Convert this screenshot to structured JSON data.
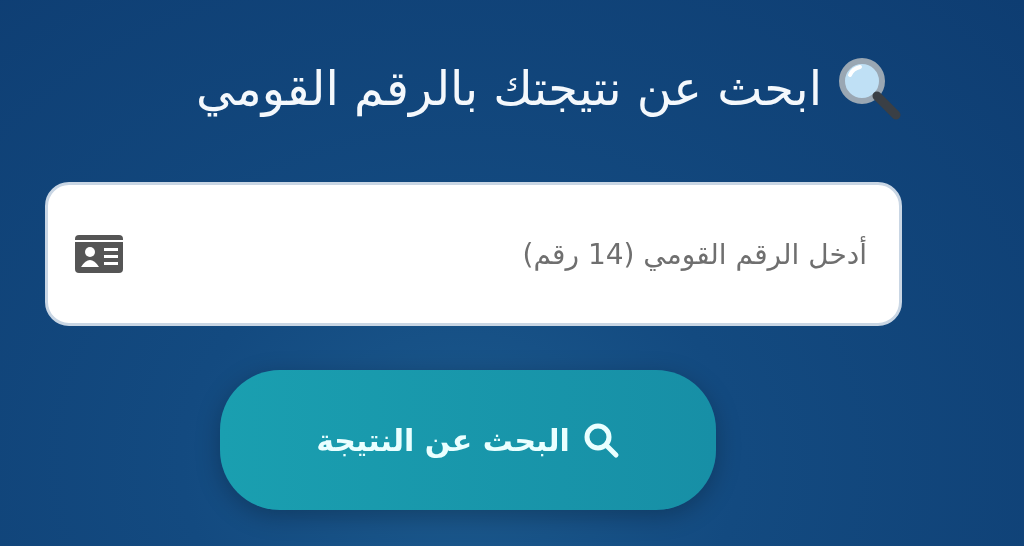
{
  "heading": {
    "title": "ابحث عن نتيجتك بالرقم القومي"
  },
  "national_id_field": {
    "placeholder": "أدخل الرقم القومي (14 رقم)"
  },
  "search_button": {
    "label": "البحث عن النتيجة"
  }
}
